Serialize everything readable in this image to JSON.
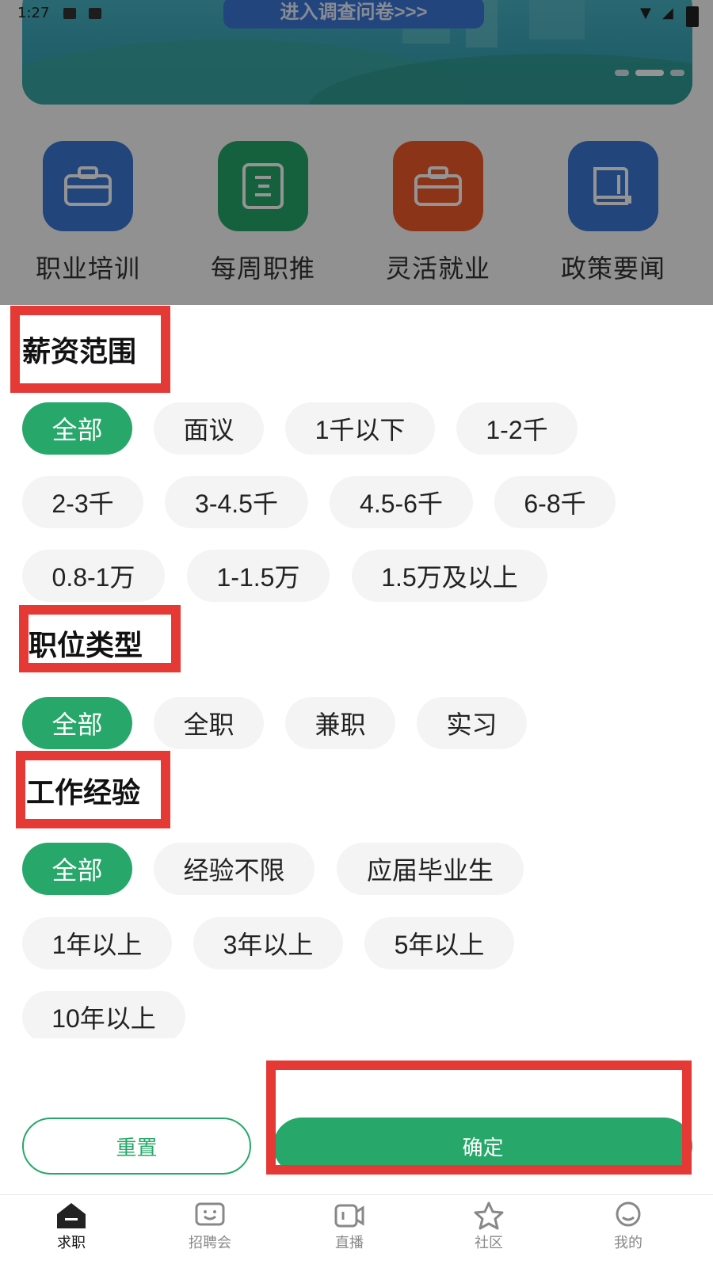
{
  "status_bar": {
    "time": "1:27"
  },
  "banner": {
    "button_label": "进入调查问卷>>>"
  },
  "quick_links": [
    {
      "label": "职业培训",
      "color": "#3b77d6",
      "icon": "briefcase-icon"
    },
    {
      "label": "每周职推",
      "color": "#27a86a",
      "icon": "clipboard-icon"
    },
    {
      "label": "灵活就业",
      "color": "#f25b2a",
      "icon": "briefcase-icon"
    },
    {
      "label": "政策要闻",
      "color": "#3b77d6",
      "icon": "book-icon"
    }
  ],
  "filters": {
    "salary": {
      "title": "薪资范围",
      "options": [
        "全部",
        "面议",
        "1千以下",
        "1-2千",
        "2-3千",
        "3-4.5千",
        "4.5-6千",
        "6-8千",
        "0.8-1万",
        "1-1.5万",
        "1.5万及以上"
      ],
      "selected": "全部"
    },
    "job_type": {
      "title": "职位类型",
      "options": [
        "全部",
        "全职",
        "兼职",
        "实习"
      ],
      "selected": "全部"
    },
    "experience": {
      "title": "工作经验",
      "options": [
        "全部",
        "经验不限",
        "应届毕业生",
        "1年以上",
        "3年以上",
        "5年以上",
        "10年以上"
      ],
      "selected": "全部"
    }
  },
  "actions": {
    "reset": "重置",
    "confirm": "确定"
  },
  "bottom_nav": [
    {
      "label": "求职",
      "icon": "home-icon",
      "active": true
    },
    {
      "label": "招聘会",
      "icon": "smiley-chat-icon",
      "active": false
    },
    {
      "label": "直播",
      "icon": "video-icon",
      "active": false
    },
    {
      "label": "社区",
      "icon": "star-icon",
      "active": false
    },
    {
      "label": "我的",
      "icon": "profile-icon",
      "active": false
    }
  ],
  "colors": {
    "accent": "#27a86a",
    "highlight": "#e53935"
  }
}
